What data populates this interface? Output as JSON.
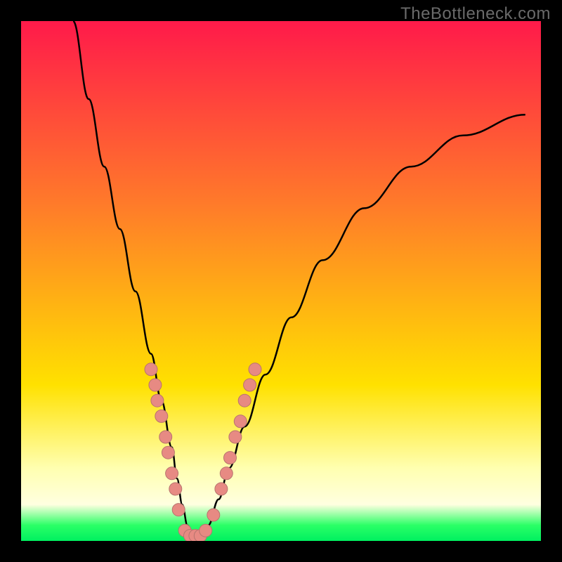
{
  "watermark": "TheBottleneck.com",
  "colors": {
    "red": "#ff1a4a",
    "orange": "#ff7a2a",
    "yellow": "#ffe100",
    "cream": "#ffffb0",
    "cream2": "#ffffe0",
    "green1": "#2aff66",
    "green2": "#00f060",
    "curve": "#000000",
    "marker_fill": "#e78a83",
    "marker_stroke": "#b7746e"
  },
  "chart_data": {
    "type": "line",
    "title": "",
    "xlabel": "",
    "ylabel": "",
    "xlim": [
      0,
      100
    ],
    "ylim": [
      0,
      100
    ],
    "grid": false,
    "legend": false,
    "series": [
      {
        "name": "bottleneck-curve",
        "x": [
          10,
          13,
          16,
          19,
          22,
          25,
          27,
          29,
          30,
          31,
          32,
          33,
          34,
          35,
          36,
          38,
          40,
          43,
          47,
          52,
          58,
          66,
          75,
          85,
          97
        ],
        "y": [
          100,
          85,
          72,
          60,
          48,
          36,
          27,
          18,
          12,
          7,
          3,
          1,
          0,
          1,
          3,
          8,
          14,
          22,
          32,
          43,
          54,
          64,
          72,
          78,
          82
        ]
      }
    ],
    "markers": [
      {
        "x": 25.0,
        "y": 33
      },
      {
        "x": 25.8,
        "y": 30
      },
      {
        "x": 26.2,
        "y": 27
      },
      {
        "x": 27.0,
        "y": 24
      },
      {
        "x": 27.8,
        "y": 20
      },
      {
        "x": 28.3,
        "y": 17
      },
      {
        "x": 29.0,
        "y": 13
      },
      {
        "x": 29.7,
        "y": 10
      },
      {
        "x": 30.3,
        "y": 6
      },
      {
        "x": 31.5,
        "y": 2
      },
      {
        "x": 32.5,
        "y": 1
      },
      {
        "x": 33.5,
        "y": 1
      },
      {
        "x": 34.5,
        "y": 1
      },
      {
        "x": 35.5,
        "y": 2
      },
      {
        "x": 37.0,
        "y": 5
      },
      {
        "x": 38.5,
        "y": 10
      },
      {
        "x": 39.5,
        "y": 13
      },
      {
        "x": 40.2,
        "y": 16
      },
      {
        "x": 41.2,
        "y": 20
      },
      {
        "x": 42.2,
        "y": 23
      },
      {
        "x": 43.0,
        "y": 27
      },
      {
        "x": 44.0,
        "y": 30
      },
      {
        "x": 45.0,
        "y": 33
      }
    ]
  }
}
